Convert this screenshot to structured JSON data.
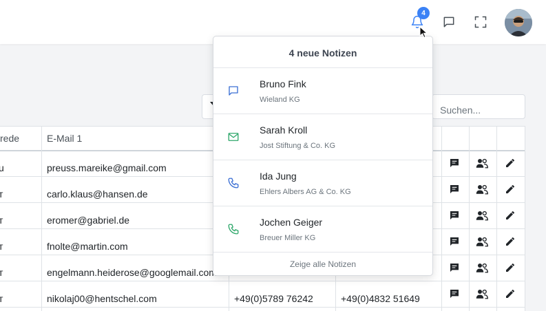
{
  "topbar": {
    "notification_count": "4",
    "icons": [
      "bell-icon",
      "chat-icon",
      "fullscreen-icon"
    ]
  },
  "search": {
    "placeholder": "Suchen..."
  },
  "table": {
    "headers": [
      "rede",
      "E-Mail 1"
    ],
    "rows": [
      {
        "salutation": "u",
        "email": "preuss.mareike@gmail.com",
        "phone1": "",
        "phone2": ""
      },
      {
        "salutation": "т",
        "email": "carlo.klaus@hansen.de",
        "phone1": "",
        "phone2": ""
      },
      {
        "salutation": "т",
        "email": "eromer@gabriel.de",
        "phone1": "",
        "phone2": ""
      },
      {
        "salutation": "т",
        "email": "fnolte@martin.com",
        "phone1": "",
        "phone2": ""
      },
      {
        "salutation": "т",
        "email": "engelmann.heiderose@googlemail.com",
        "phone1": "",
        "phone2": ""
      },
      {
        "salutation": "т",
        "email": "nikolaj00@hentschel.com",
        "phone1": "+49(0)5789 76242",
        "phone2": "+49(0)4832 51649"
      }
    ]
  },
  "notifications": {
    "header": "4 neue Notizen",
    "items": [
      {
        "icon": "chat-icon",
        "color": "#3b6fd4",
        "name": "Bruno Fink",
        "company": "Wieland KG"
      },
      {
        "icon": "mail-icon",
        "color": "#2fa86b",
        "name": "Sarah Kroll",
        "company": "Jost Stiftung & Co. KG"
      },
      {
        "icon": "phone-icon",
        "color": "#3b6fd4",
        "name": "Ida Jung",
        "company": "Ehlers Albers AG & Co. KG"
      },
      {
        "icon": "phone-icon",
        "color": "#2fa86b",
        "name": "Jochen Geiger",
        "company": "Breuer Miller KG"
      }
    ],
    "footer": "Zeige alle Notizen"
  },
  "colors": {
    "accent": "#3b82f6",
    "blue_icon": "#3b6fd4",
    "green_icon": "#2fa86b"
  }
}
